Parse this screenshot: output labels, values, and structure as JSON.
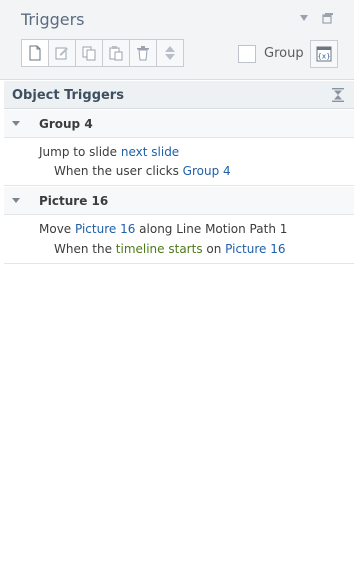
{
  "panel": {
    "title": "Triggers"
  },
  "toolbar": {
    "buttons": [
      "new-trigger",
      "edit-trigger",
      "copy-trigger",
      "paste-trigger",
      "delete-trigger",
      "move-up-down"
    ],
    "group_label": "Group",
    "group_checked": false
  },
  "section": {
    "title": "Object Triggers"
  },
  "groups": [
    {
      "name": "Group 4",
      "trigger": {
        "l1_a": "Jump to slide ",
        "l1_link": "next slide",
        "l2_a": "When the user clicks ",
        "l2_link": "Group 4"
      }
    },
    {
      "name": "Picture 16",
      "trigger": {
        "l1_a": "Move ",
        "l1_link": "Picture 16",
        "l1_b": " along Line Motion Path 1",
        "l2_a": "When the ",
        "l2_event": "timeline starts",
        "l2_b": " on ",
        "l2_link": "Picture 16"
      }
    }
  ],
  "colors": {
    "link": "#1f5fa8",
    "event": "#4d7a1a",
    "title": "#5a6c80"
  }
}
